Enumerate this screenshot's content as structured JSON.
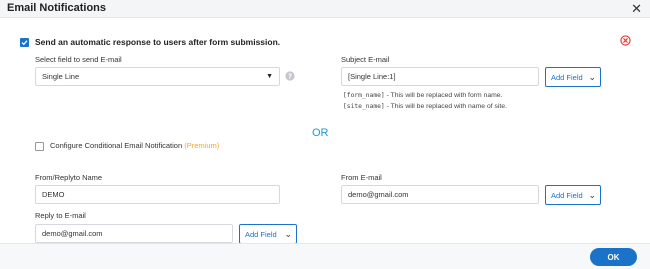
{
  "dialog": {
    "title": "Email Notifications",
    "close_icon": "close-icon"
  },
  "auto_response": {
    "checkbox_label": "Send an automatic response to users after form submission.",
    "checked": true,
    "remove_icon": "remove-circle-icon"
  },
  "send_field": {
    "label": "Select field to send E-mail",
    "value": "Single Line",
    "help_icon": "question-icon"
  },
  "subject": {
    "label": "Subject E-mail",
    "value": "[Single Line:1]",
    "add_field": "Add Field",
    "hint1_code": "[form_name]",
    "hint1_text": " - This will be replaced with form name.",
    "hint2_code": "[site_name]",
    "hint2_text": " - This will be replaced with name of site."
  },
  "or_text": "OR",
  "conditional": {
    "label": "Configure Conditional Email Notification",
    "premium": "(Premium)",
    "checked": false
  },
  "from_name": {
    "label": "From/Replyto Name",
    "value": "DEMO"
  },
  "from_email": {
    "label": "From E-mail",
    "value": "demo@gmail.com",
    "add_field": "Add Field"
  },
  "reply_to": {
    "label": "Reply to E-mail",
    "value": "demo@gmail.com",
    "add_field": "Add Field"
  },
  "footer": {
    "ok_label": "OK"
  },
  "colors": {
    "accent": "#1a73c8",
    "or": "#1a9bd7",
    "premium": "#f5a623",
    "remove": "#e53935"
  }
}
